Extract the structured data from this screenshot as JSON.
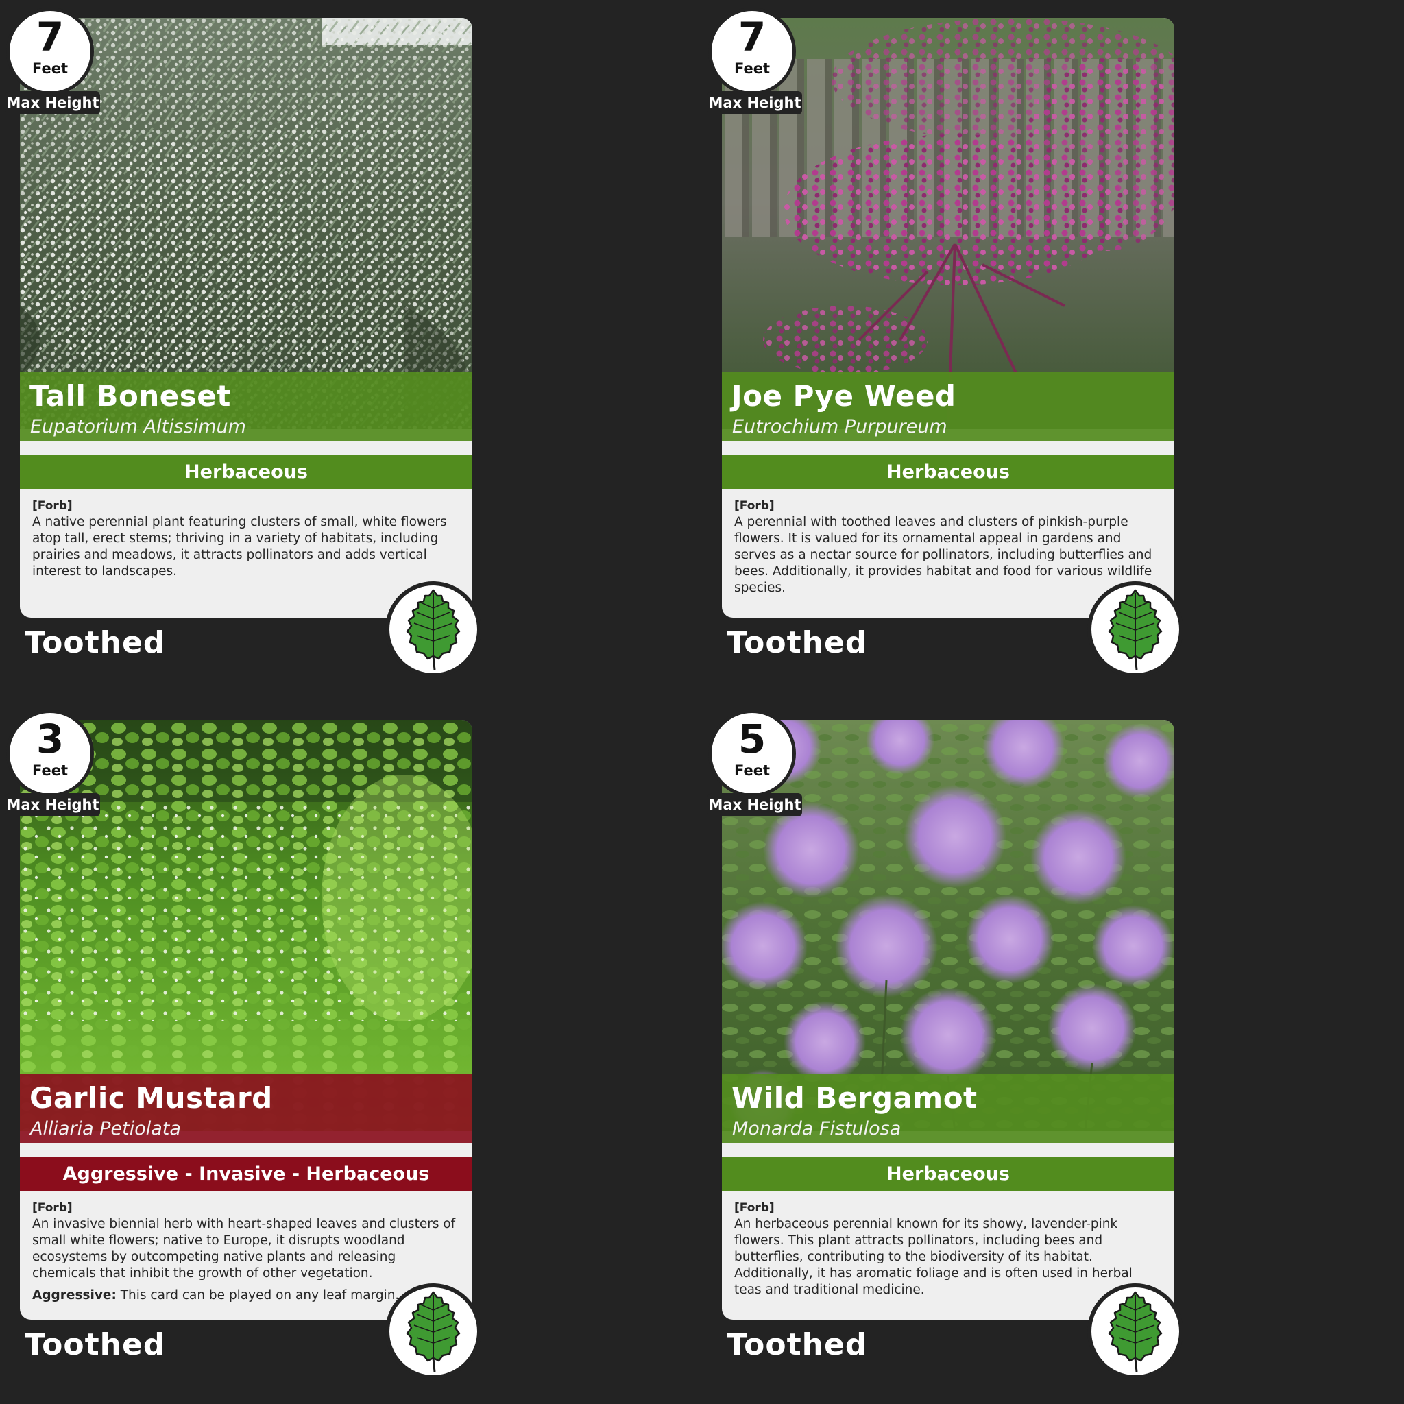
{
  "colors": {
    "background": "#232323",
    "herbaceous_green": "#528c1e",
    "invasive_red": "#8b0d1c",
    "card_body": "#efefef",
    "leaf_green": "#3f9a32"
  },
  "cards": [
    {
      "height_value": "7",
      "height_unit": "Feet",
      "height_label": "Max Height",
      "common_name": "Tall Boneset",
      "scientific_name": "Eupatorium Altissimum",
      "category": "Herbaceous",
      "tag": "[Forb]",
      "description": "A native perennial plant featuring clusters of small, white flowers atop tall, erect stems; thriving in a variety of habitats, including prairies and meadows, it attracts pollinators and adds vertical interest to landscapes.",
      "leaf_margin": "Toothed",
      "leaf_icon": "toothed-leaf-icon",
      "photo": "white-flowering-shrub-photo"
    },
    {
      "height_value": "7",
      "height_unit": "Feet",
      "height_label": "Max Height",
      "common_name": "Joe Pye Weed",
      "scientific_name": "Eutrochium Purpureum",
      "category": "Herbaceous",
      "tag": "[Forb]",
      "description": "A perennial with toothed leaves and clusters of pinkish-purple flowers. It is valued for its ornamental appeal in gardens and serves as a nectar source for pollinators, including butterflies and bees. Additionally, it provides habitat and food for various wildlife species.",
      "leaf_margin": "Toothed",
      "leaf_icon": "toothed-leaf-icon",
      "photo": "pink-flower-cluster-photo"
    },
    {
      "height_value": "3",
      "height_unit": "Feet",
      "height_label": "Max Height",
      "common_name": "Garlic Mustard",
      "scientific_name": "Alliaria Petiolata",
      "category": "Aggressive - Invasive - Herbaceous",
      "tag": "[Forb]",
      "description": "An invasive biennial herb with heart-shaped leaves and clusters of small white flowers; native to Europe, it disrupts woodland ecosystems by outcompeting native plants and releasing chemicals that inhibit the growth of other vegetation.",
      "extra_label": "Aggressive:",
      "extra_text": " This card can be played on any leaf margin.",
      "leaf_margin": "Toothed",
      "leaf_icon": "toothed-leaf-icon",
      "photo": "green-groundcover-photo"
    },
    {
      "height_value": "5",
      "height_unit": "Feet",
      "height_label": "Max Height",
      "common_name": "Wild Bergamot",
      "scientific_name": "Monarda Fistulosa",
      "category": "Herbaceous",
      "tag": "[Forb]",
      "description": "An herbaceous perennial known for its showy, lavender-pink flowers. This plant attracts pollinators, including bees and butterflies, contributing to the biodiversity of its habitat. Additionally, it has aromatic foliage and is often used in herbal teas and traditional medicine.",
      "leaf_margin": "Toothed",
      "leaf_icon": "toothed-leaf-icon",
      "photo": "lavender-flowers-photo"
    }
  ]
}
